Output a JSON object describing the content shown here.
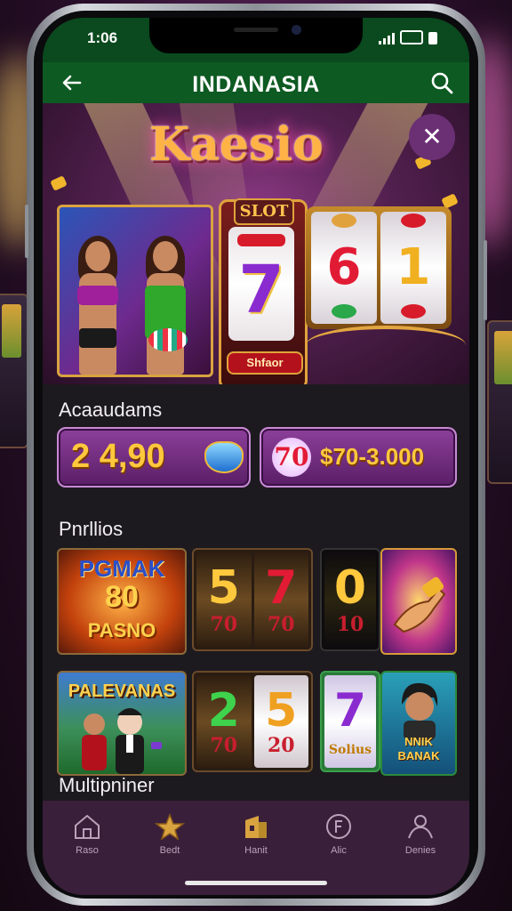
{
  "status_bar": {
    "time": "1:06"
  },
  "app_bar": {
    "title": "INDANASIA"
  },
  "hero": {
    "logo_text": "Kaesio",
    "slot_tag": "SLOT",
    "slot_label": "Shfaor",
    "reels": [
      "7",
      "6",
      "1"
    ]
  },
  "sections": {
    "jackpots_title": "Acaaudams",
    "portfolio_title": "Pnrllios",
    "multiplayer_title": "Multipniner"
  },
  "jackpots": [
    {
      "value": "2 4,90"
    },
    {
      "badge": "70",
      "value": "$70-3.000"
    }
  ],
  "games_row1": [
    {
      "line1": "PGMAK",
      "line2": "80",
      "line3": "PASNO"
    },
    {
      "top": [
        "5",
        "7"
      ],
      "bottom": [
        "70",
        "70"
      ]
    },
    {
      "top": "0",
      "bottom": "10"
    },
    {
      "name": "bonus-hand"
    }
  ],
  "games_row2": [
    {
      "title": "PALEVANAS"
    },
    {
      "top": [
        "2",
        "5"
      ],
      "bottom": [
        "70",
        "20"
      ]
    },
    {
      "top": "7",
      "bottom": "Solius"
    },
    {
      "line1": "NNIK",
      "line2": "BANAK"
    }
  ],
  "tabs": [
    {
      "label": "Raso",
      "icon": "home-icon"
    },
    {
      "label": "Bedt",
      "icon": "star-icon"
    },
    {
      "label": "Hanit",
      "icon": "building-icon"
    },
    {
      "label": "Alic",
      "icon": "coin-icon"
    },
    {
      "label": "Denies",
      "icon": "person-icon"
    }
  ],
  "colors": {
    "app_bar": "#0d5a22",
    "accent_gold": "#ffc83d",
    "tab_bar": "#3a1f3a",
    "jackpot_purple": "#8c3f9a"
  }
}
